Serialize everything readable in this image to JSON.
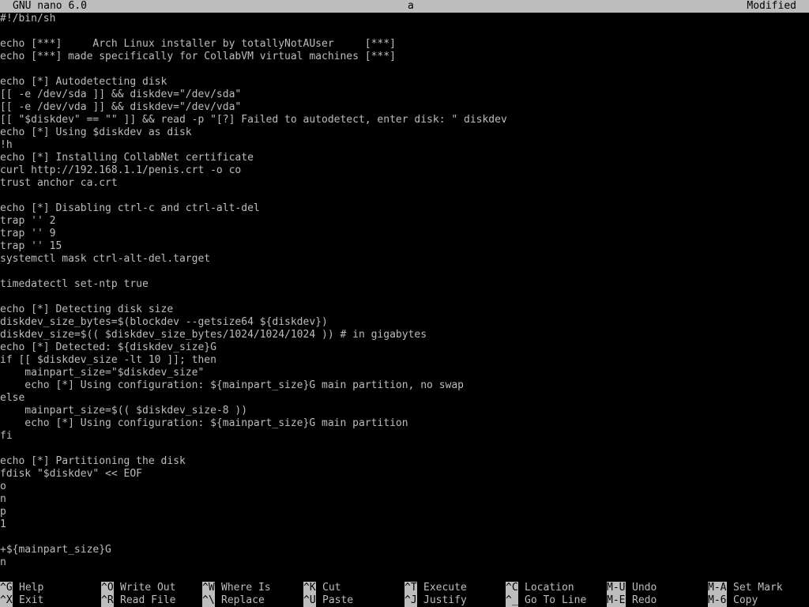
{
  "header": {
    "app": "GNU nano 6.0",
    "filename": "a",
    "status": "Modified"
  },
  "editor": {
    "lines": [
      "#!/bin/sh",
      "",
      "echo [***]     Arch Linux installer by totallyNotAUser     [***]",
      "echo [***] made specifically for CollabVM virtual machines [***]",
      "",
      "echo [*] Autodetecting disk",
      "[[ -e /dev/sda ]] && diskdev=\"/dev/sda\"",
      "[[ -e /dev/vda ]] && diskdev=\"/dev/vda\"",
      "[[ \"$diskdev\" == \"\" ]] && read -p \"[?] Failed to autodetect, enter disk: \" diskdev",
      "echo [*] Using $diskdev as disk",
      "!h",
      "echo [*] Installing CollabNet certificate",
      "curl http://192.168.1.1/penis.crt -o co",
      "trust anchor ca.crt",
      "",
      "echo [*] Disabling ctrl-c and ctrl-alt-del",
      "trap '' 2",
      "trap '' 9",
      "trap '' 15",
      "systemctl mask ctrl-alt-del.target",
      "",
      "timedatectl set-ntp true",
      "",
      "echo [*] Detecting disk size",
      "diskdev_size_bytes=$(blockdev --getsize64 ${diskdev})",
      "diskdev_size=$(( $diskdev_size_bytes/1024/1024/1024 )) # in gigabytes",
      "echo [*] Detected: ${diskdev_size}G",
      "if [[ $diskdev_size -lt 10 ]]; then",
      "    mainpart_size=\"$diskdev_size\"",
      "    echo [*] Using configuration: ${mainpart_size}G main partition, no swap",
      "else",
      "    mainpart_size=$(( $diskdev_size-8 ))",
      "    echo [*] Using configuration: ${mainpart_size}G main partition",
      "fi",
      "",
      "echo [*] Partitioning the disk",
      "fdisk \"$diskdev\" << EOF",
      "o",
      "n",
      "p",
      "1",
      "",
      "+${mainpart_size}G",
      "n"
    ]
  },
  "shortcuts": [
    {
      "key": "^G",
      "label": "Help"
    },
    {
      "key": "^X",
      "label": "Exit"
    },
    {
      "key": "^O",
      "label": "Write Out"
    },
    {
      "key": "^R",
      "label": "Read File"
    },
    {
      "key": "^W",
      "label": "Where Is"
    },
    {
      "key": "^\\",
      "label": "Replace"
    },
    {
      "key": "^K",
      "label": "Cut"
    },
    {
      "key": "^U",
      "label": "Paste"
    },
    {
      "key": "^T",
      "label": "Execute"
    },
    {
      "key": "^J",
      "label": "Justify"
    },
    {
      "key": "^C",
      "label": "Location"
    },
    {
      "key": "^_",
      "label": "Go To Line"
    },
    {
      "key": "M-U",
      "label": "Undo"
    },
    {
      "key": "M-E",
      "label": "Redo"
    },
    {
      "key": "M-A",
      "label": "Set Mark"
    },
    {
      "key": "M-6",
      "label": "Copy"
    }
  ],
  "colors": {
    "background": "#000000",
    "foreground": "#bdbdbd",
    "inverse_bg": "#bdbdbd",
    "inverse_fg": "#000000"
  }
}
